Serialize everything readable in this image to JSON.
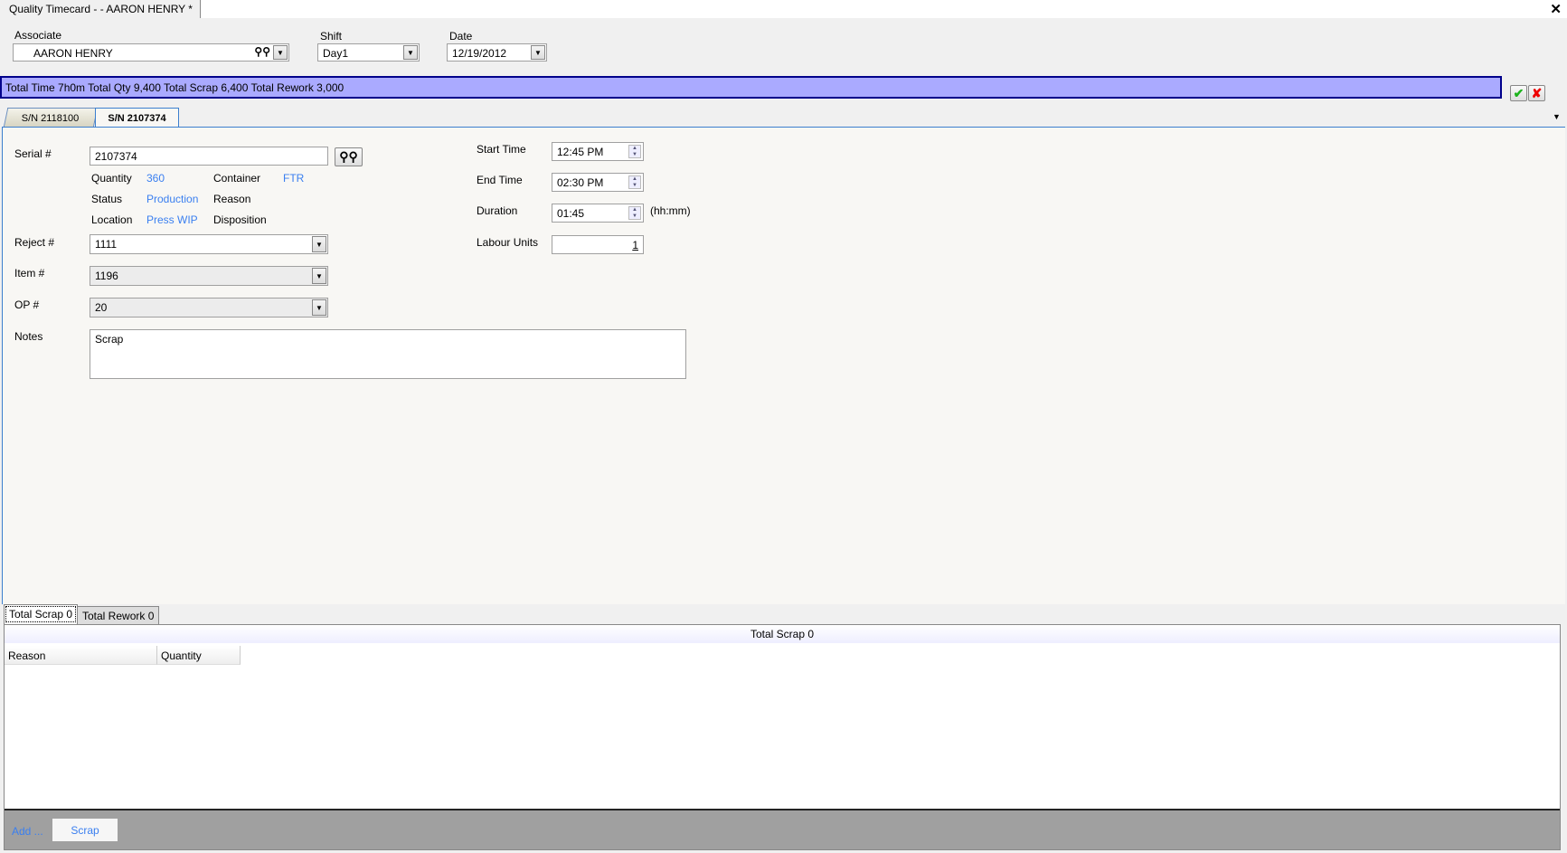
{
  "window": {
    "title": "Quality Timecard - - AARON HENRY *",
    "close_icon": "close-icon"
  },
  "header": {
    "associate_label": "Associate",
    "associate_value": "AARON HENRY",
    "shift_label": "Shift",
    "shift_value": "Day1",
    "date_label": "Date",
    "date_value": "12/19/2012"
  },
  "summary": {
    "text": "Total Time 7h0m  Total Qty 9,400  Total Scrap 6,400 Total Rework 3,000",
    "accent": "#aaaaff"
  },
  "tabs": [
    {
      "label": "S/N 2118100"
    },
    {
      "label": "S/N 2107374",
      "active": true
    }
  ],
  "form": {
    "serial_label": "Serial #",
    "serial_value": "2107374",
    "quantity_label": "Quantity",
    "quantity_value": "360",
    "container_label": "Container",
    "container_value": "FTR",
    "status_label": "Status",
    "status_value": "Production",
    "reason_label": "Reason",
    "location_label": "Location",
    "location_value": "Press WIP",
    "disposition_label": "Disposition",
    "reject_label": "Reject #",
    "reject_value": "1111",
    "item_label": "Item #",
    "item_value": "1196",
    "op_label": "OP #",
    "op_value": "20",
    "notes_label": "Notes",
    "notes_value": "Scrap",
    "start_label": "Start Time",
    "start_value": "12:45 PM",
    "end_label": "End Time",
    "end_value": "02:30 PM",
    "duration_label": "Duration",
    "duration_value": "01:45",
    "duration_unit": "(hh:mm)",
    "labour_label": "Labour Units",
    "labour_value": "1"
  },
  "bottom": {
    "tabs": [
      {
        "label": "Total Scrap 0"
      },
      {
        "label": "Total Rework 0"
      }
    ],
    "grid_title": "Total Scrap 0",
    "columns": [
      "Reason",
      "Quantity"
    ],
    "add_label": "Add ...",
    "scrap_button": "Scrap"
  }
}
